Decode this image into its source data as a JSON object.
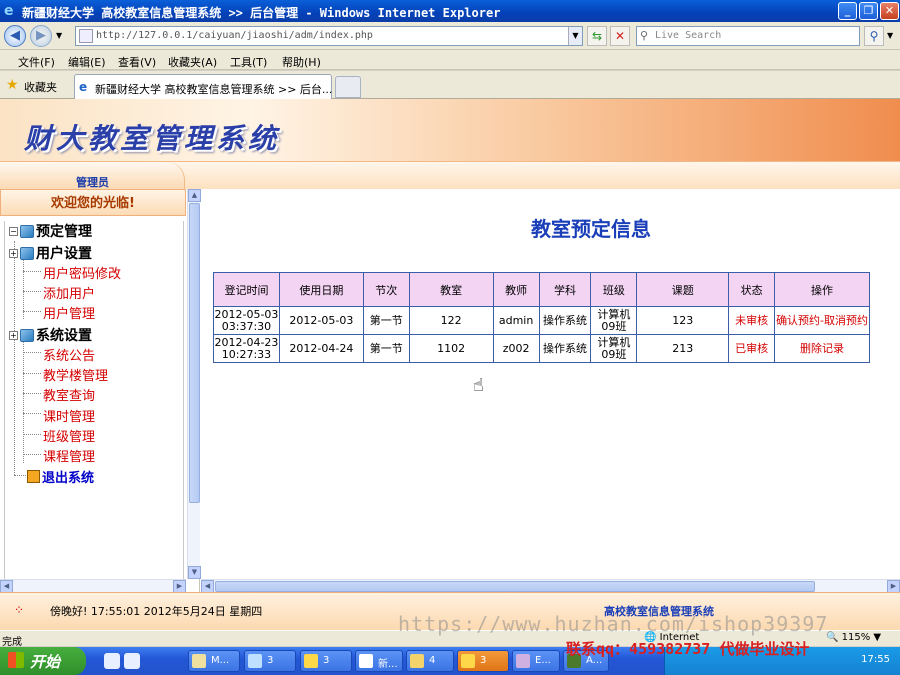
{
  "browser": {
    "window_title": "新疆财经大学 高校教室信息管理系统 >> 后台管理 - Windows Internet Explorer",
    "url": "http://127.0.0.1/caiyuan/jiaoshi/adm/index.php",
    "search_placeholder": "Live Search",
    "menu": [
      "文件(F)",
      "编辑(E)",
      "查看(V)",
      "收藏夹(A)",
      "工具(T)",
      "帮助(H)"
    ],
    "favorites_label": "收藏夹",
    "tab_title": "新疆财经大学 高校教室信息管理系统 >> 后台...",
    "status_text": "完成",
    "zone": "Internet",
    "zoom": "115%"
  },
  "app": {
    "system_title": "财大教室管理系统",
    "role": "管理员",
    "welcome": "欢迎您的光临!",
    "tree": {
      "booking": "预定管理",
      "user_settings": "用户设置",
      "user_items": [
        "用户密码修改",
        "添加用户",
        "用户管理"
      ],
      "system_settings": "系统设置",
      "system_items": [
        "系统公告",
        "教学楼管理",
        "教室查询",
        "课时管理",
        "班级管理",
        "课程管理"
      ],
      "exit": "退出系统"
    },
    "main": {
      "heading": "教室预定信息",
      "columns": [
        "登记时间",
        "使用日期",
        "节次",
        "教室",
        "教师",
        "学科",
        "班级",
        "课题",
        "状态",
        "操作"
      ],
      "rows": [
        {
          "reg_date": "2012-05-03",
          "reg_time": "03:37:30",
          "use_date": "2012-05-03",
          "period": "第一节",
          "room": "122",
          "teacher": "admin",
          "subject": "操作系统",
          "class1": "计算机",
          "class2": "09班",
          "topic": "123",
          "status": "未审核",
          "action": "确认预约-取消预约"
        },
        {
          "reg_date": "2012-04-23",
          "reg_time": "10:27:33",
          "use_date": "2012-04-24",
          "period": "第一节",
          "room": "1102",
          "teacher": "z002",
          "subject": "操作系统",
          "class1": "计算机",
          "class2": "09班",
          "topic": "213",
          "status": "已审核",
          "action": "删除记录"
        }
      ]
    },
    "footer": {
      "greeting_time": "傍晚好! 17:55:01 2012年5月24日 星期四",
      "system_name": "高校教室信息管理系统"
    }
  },
  "taskbar": {
    "start": "开始",
    "buttons": [
      "M...",
      "3",
      "3",
      "新...",
      "4",
      "3",
      "E...",
      "A..."
    ],
    "clock": "17:55"
  },
  "watermark": {
    "line1": "https://www.huzhan.com/ishop39397",
    "line2": "联系qq：459382737 代做毕业设计"
  }
}
